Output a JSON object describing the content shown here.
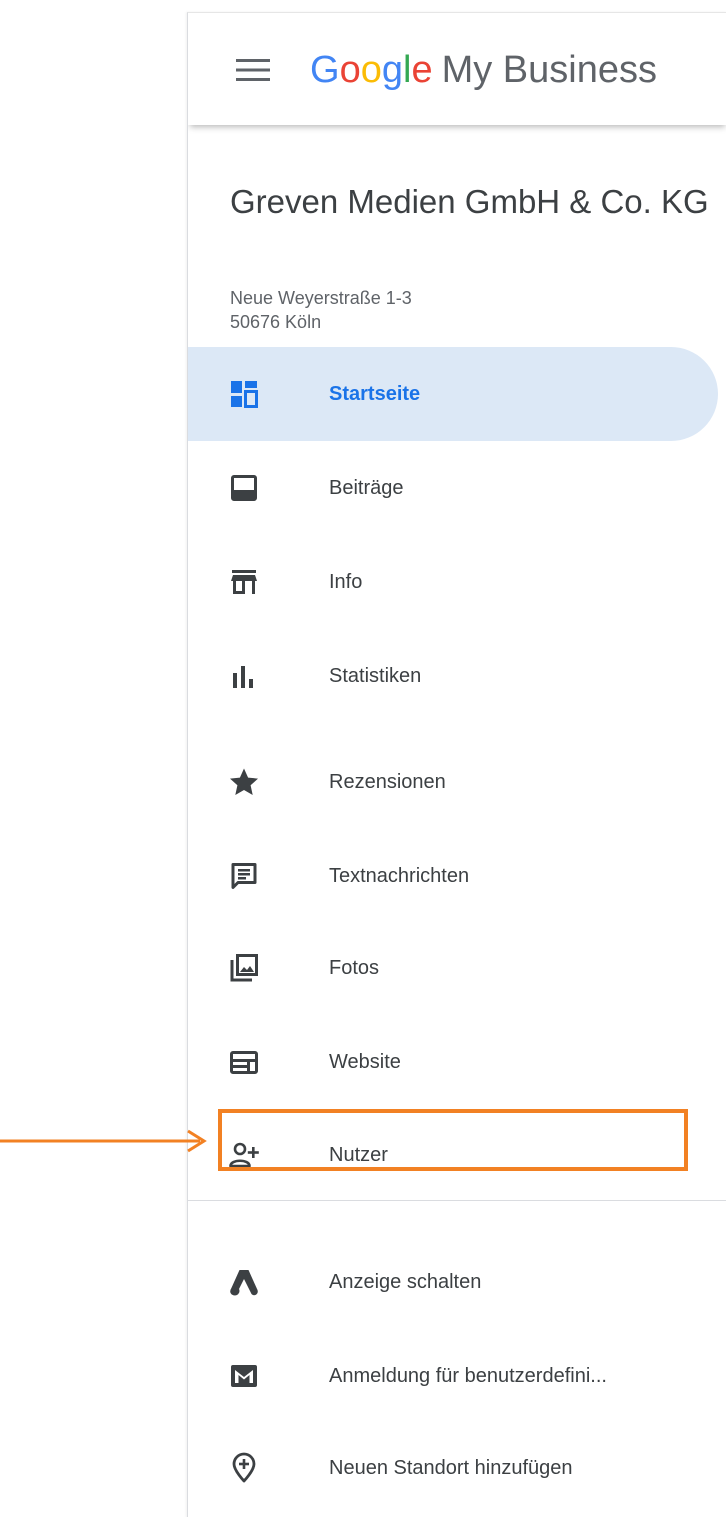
{
  "header": {
    "logo_letters": [
      "G",
      "o",
      "o",
      "g",
      "l",
      "e"
    ],
    "logo_product": "My Business"
  },
  "business": {
    "name": "Greven Medien GmbH & Co. KG",
    "address_line1": "Neue Weyerstraße 1-3",
    "address_line2": "50676 Köln"
  },
  "nav": {
    "items": [
      {
        "label": "Startseite",
        "icon": "dashboard-icon",
        "active": true
      },
      {
        "label": "Beiträge",
        "icon": "posts-icon"
      },
      {
        "label": "Info",
        "icon": "storefront-icon"
      },
      {
        "label": "Statistiken",
        "icon": "bar-chart-icon"
      },
      {
        "label": "Rezensionen",
        "icon": "star-icon"
      },
      {
        "label": "Textnachrichten",
        "icon": "message-icon"
      },
      {
        "label": "Fotos",
        "icon": "photo-library-icon"
      },
      {
        "label": "Website",
        "icon": "web-icon"
      },
      {
        "label": "Nutzer",
        "icon": "person-add-icon"
      }
    ],
    "secondary_items": [
      {
        "label": "Anzeige schalten",
        "icon": "google-ads-icon"
      },
      {
        "label": "Anmeldung für benutzerdefini...",
        "icon": "gmail-icon"
      },
      {
        "label": "Neuen Standort hinzufügen",
        "icon": "add-location-icon"
      }
    ]
  },
  "colors": {
    "active_bg": "#dce8f6",
    "active_text": "#1a73e8",
    "icon": "#3c4043",
    "highlight": "#f28123"
  }
}
